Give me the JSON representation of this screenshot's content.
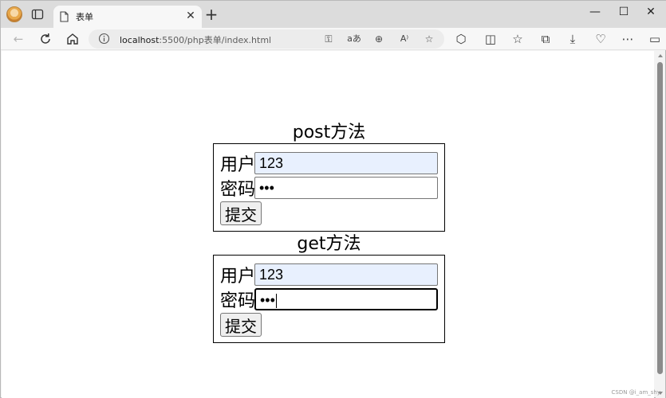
{
  "browser": {
    "tab_title": "表单",
    "url_host": "localhost",
    "url_path": ":5500/php表单/index.html"
  },
  "icons": {
    "back": "arrow-left-icon",
    "refresh": "refresh-icon",
    "home": "home-icon"
  },
  "post_form": {
    "title": "post方法",
    "username_label": "用户",
    "username_value": "123",
    "password_label": "密码",
    "password_value": "•••",
    "submit_label": "提交"
  },
  "get_form": {
    "title": "get方法",
    "username_label": "用户",
    "username_value": "123",
    "password_label": "密码",
    "password_value": "•••",
    "submit_label": "提交"
  },
  "watermark": "CSDN @i_am_shy",
  "colors": {
    "autofill": "#e8f0fe",
    "tabstrip": "#dcdcdc"
  }
}
